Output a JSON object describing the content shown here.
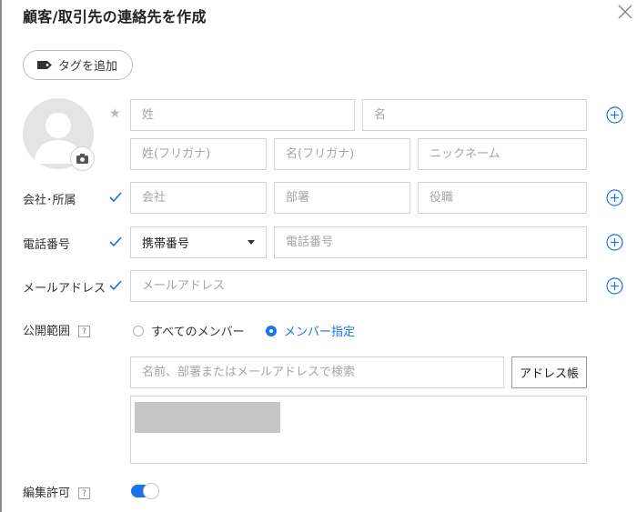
{
  "dialog": {
    "title": "顧客/取引先の連絡先を作成"
  },
  "tag_button": {
    "label": "タグを追加"
  },
  "name": {
    "last_placeholder": "姓",
    "first_placeholder": "名",
    "last_kana_placeholder": "姓(フリガナ)",
    "first_kana_placeholder": "名(フリガナ)",
    "nickname_placeholder": "ニックネーム"
  },
  "company": {
    "label": "会社･所属",
    "company_placeholder": "会社",
    "department_placeholder": "部署",
    "title_placeholder": "役職"
  },
  "phone": {
    "label": "電話番号",
    "type_selected": "携帯番号",
    "number_placeholder": "電話番号"
  },
  "email": {
    "label": "メールアドレス",
    "placeholder": "メールアドレス"
  },
  "visibility": {
    "label": "公開範囲",
    "help": "?",
    "option_all": "すべてのメンバー",
    "option_specified": "メンバー指定",
    "selected": "メンバー指定",
    "search_placeholder": "名前、部署またはメールアドレスで検索",
    "address_book_button": "アドレス帳"
  },
  "edit_permission": {
    "label": "編集許可",
    "help": "?",
    "enabled": true
  },
  "colors": {
    "accent": "#1a73e8",
    "border": "#d3d3d3",
    "placeholder": "#a5a5a5"
  },
  "icons": {
    "close": "close-icon",
    "tag": "tag-icon",
    "avatar": "person-placeholder-icon",
    "camera": "camera-icon",
    "star": "star-icon",
    "check": "check-icon",
    "add": "plus-circle-icon"
  }
}
